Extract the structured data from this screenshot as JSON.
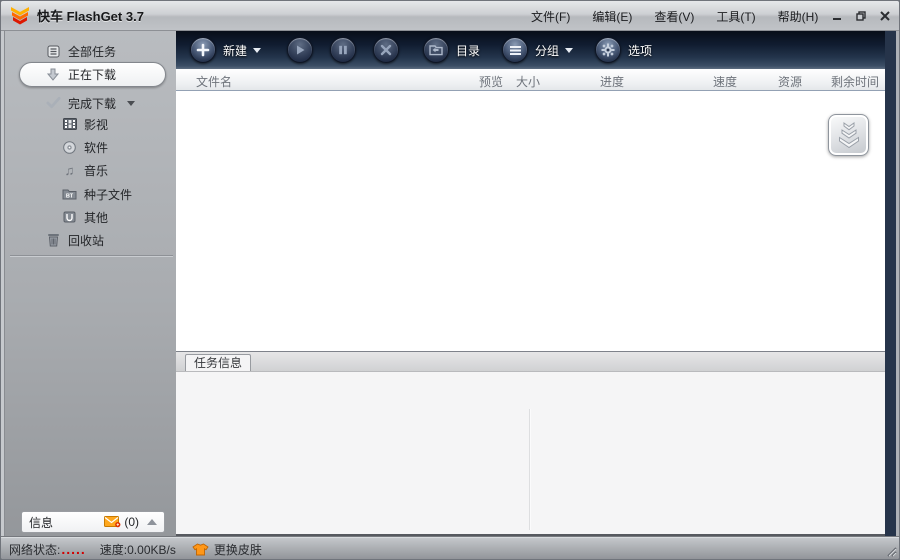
{
  "window": {
    "title": "快车 FlashGet 3.7"
  },
  "menubar": {
    "items": [
      {
        "label": "文件(F)"
      },
      {
        "label": "编辑(E)"
      },
      {
        "label": "查看(V)"
      },
      {
        "label": "工具(T)"
      },
      {
        "label": "帮助(H)"
      }
    ]
  },
  "toolbar": {
    "new_label": "新建",
    "directory_label": "目录",
    "group_label": "分组",
    "options_label": "选项"
  },
  "sidebar": {
    "items": [
      {
        "label": "全部任务"
      },
      {
        "label": "正在下载"
      },
      {
        "label": "完成下载"
      },
      {
        "label": "影视"
      },
      {
        "label": "软件"
      },
      {
        "label": "音乐"
      },
      {
        "label": "种子文件"
      },
      {
        "label": "其他"
      },
      {
        "label": "回收站"
      }
    ]
  },
  "list": {
    "columns": [
      "文件名",
      "预览",
      "大小",
      "进度",
      "速度",
      "资源",
      "剩余时间"
    ]
  },
  "task_panel": {
    "tab_label": "任务信息"
  },
  "info_bar": {
    "label": "信息",
    "count": "(0)"
  },
  "statusbar": {
    "network_label": "网络状态:",
    "network_dots": ".....",
    "speed": "速度:0.00KB/s",
    "skin_label": "更换皮肤"
  },
  "colors": {
    "brand_orange": "#ff8a00",
    "toolbar_navy": "#1b2940",
    "titlebar_silver": "#c3c6ca",
    "status_red": "#d20000",
    "selected_pill": "#ffffff",
    "panel_bg": "#f5f5f6"
  }
}
